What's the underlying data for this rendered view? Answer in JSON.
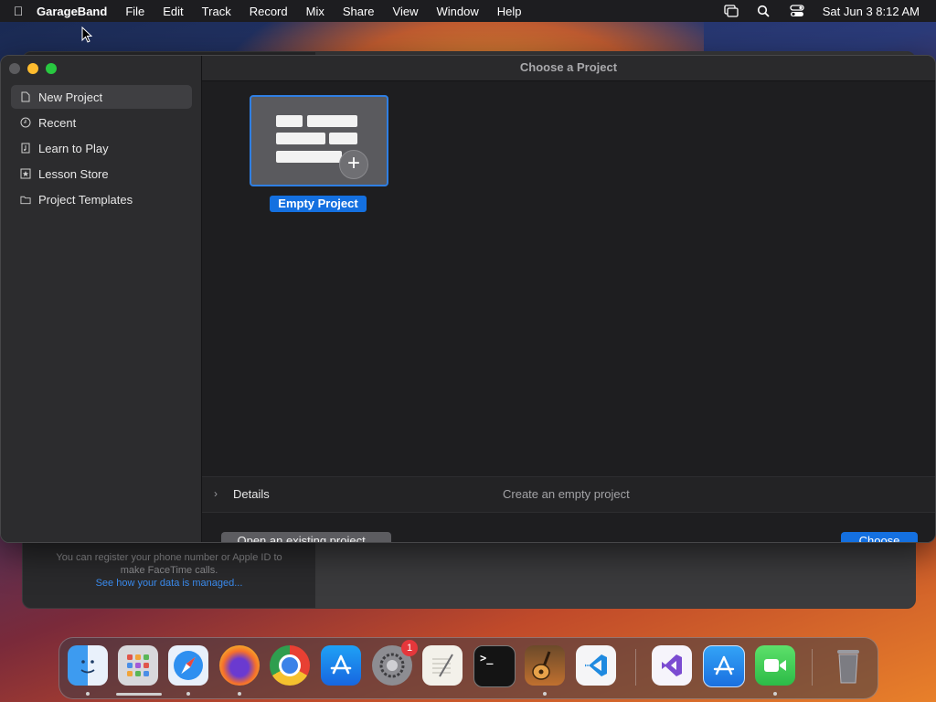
{
  "menubar": {
    "app_name": "GarageBand",
    "menus": [
      "File",
      "Edit",
      "Track",
      "Record",
      "Mix",
      "Share",
      "View",
      "Window",
      "Help"
    ],
    "clock": "Sat Jun 3  8:12 AM"
  },
  "background_window": {
    "note_line1": "You can register your phone number or Apple ID to",
    "note_line2": "make FaceTime calls.",
    "link": "See how your data is managed..."
  },
  "window": {
    "title": "Choose a Project",
    "sidebar": {
      "items": [
        {
          "label": "New Project",
          "icon": "document-icon",
          "selected": true
        },
        {
          "label": "Recent",
          "icon": "clock-icon",
          "selected": false
        },
        {
          "label": "Learn to Play",
          "icon": "music-book-icon",
          "selected": false
        },
        {
          "label": "Lesson Store",
          "icon": "star-icon",
          "selected": false
        },
        {
          "label": "Project Templates",
          "icon": "folder-icon",
          "selected": false
        }
      ]
    },
    "project_tile": {
      "label": "Empty Project"
    },
    "details": {
      "label": "Details",
      "description": "Create an empty project"
    },
    "buttons": {
      "open_existing": "Open an existing project...",
      "choose": "Choose"
    }
  },
  "dock": {
    "apps": [
      "Finder",
      "Launchpad",
      "Safari",
      "Firefox",
      "Chrome",
      "App Store",
      "System Preferences",
      "TextEdit",
      "Terminal",
      "GarageBand",
      "Visual Studio Code",
      "Visual Studio",
      "Xcode Installer",
      "FaceTime",
      "Trash"
    ],
    "settings_badge": "1"
  },
  "colors": {
    "accent": "#1470e0",
    "sidebar_bg": "#2c2c2e",
    "content_bg": "#1e1e20",
    "selection": "#3f3f42"
  }
}
